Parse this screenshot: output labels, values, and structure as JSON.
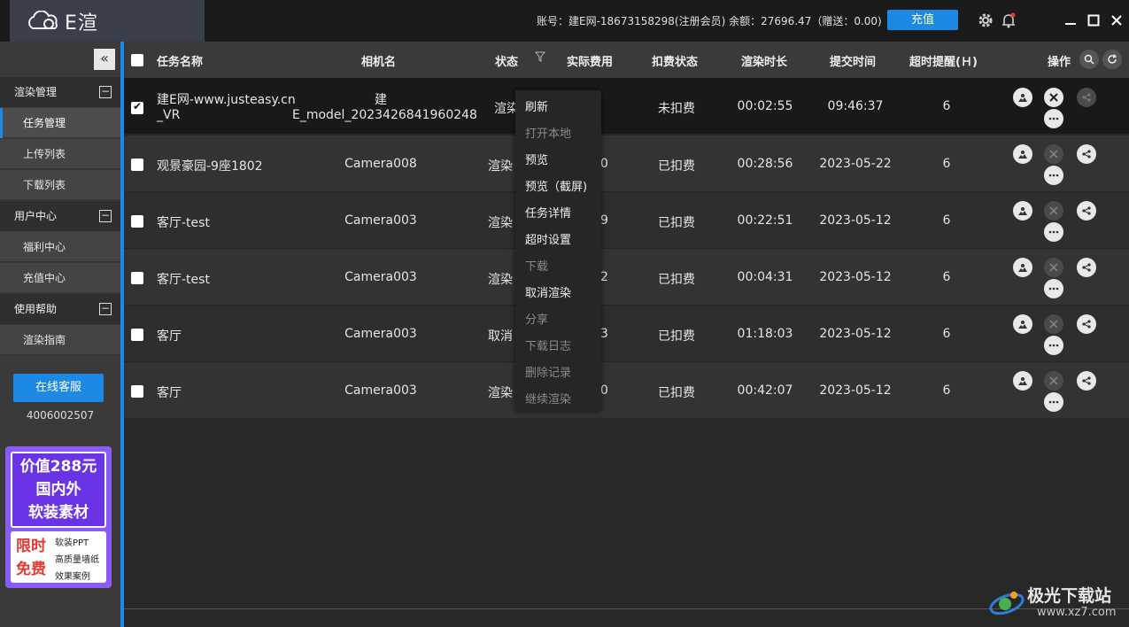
{
  "app": {
    "logo_text": "E渲",
    "account_info": "账号：建E网-18673158298(注册会员) 余额：27696.47（赠送：0.00)",
    "recharge_label": "充值"
  },
  "sidebar": {
    "collapse_glyph": "«",
    "groups": [
      {
        "label": "渲染管理",
        "toggle": "−"
      },
      {
        "label": "用户中心",
        "toggle": "−"
      },
      {
        "label": "使用帮助",
        "toggle": "−"
      }
    ],
    "items": [
      {
        "label": "任务管理"
      },
      {
        "label": "上传列表"
      },
      {
        "label": "下载列表"
      },
      {
        "label": "福利中心"
      },
      {
        "label": "充值中心"
      },
      {
        "label": "渲染指南"
      }
    ],
    "service_button": "在线客服",
    "phone": "4006002507",
    "promo": {
      "line1": "价值288元",
      "line2": "国内外",
      "line3": "软装素材",
      "badge1": "限时",
      "badge2": "免费",
      "list": [
        "软装PPT",
        "高质量墙纸",
        "效果案例"
      ]
    }
  },
  "table": {
    "headers": {
      "name": "任务名称",
      "camera": "相机名",
      "status": "状态",
      "cost": "实际费用",
      "charge_status": "扣费状态",
      "duration": "渲染时长",
      "submit_time": "提交时间",
      "timeout": "超时提醒(Ｈ)",
      "ops": "操作"
    },
    "rows": [
      {
        "name1": "建E网-www.justeasy.cn",
        "name2": "_VR",
        "camera1": "建",
        "camera2": "E_model_2023426841960248",
        "status": "渲染",
        "cost": "",
        "charge": "未扣费",
        "duration": "00:02:55",
        "time": "09:46:37",
        "timeout": "6"
      },
      {
        "name1": "观景豪园-9座1802",
        "name2": "",
        "camera1": "Camera008",
        "camera2": "",
        "status": "渲染",
        "cost": "0",
        "charge": "已扣费",
        "duration": "00:28:56",
        "time": "2023-05-22",
        "timeout": "6"
      },
      {
        "name1": "客厅-test",
        "name2": "",
        "camera1": "Camera003",
        "camera2": "",
        "status": "渲染",
        "cost": "9",
        "charge": "已扣费",
        "duration": "00:22:51",
        "time": "2023-05-12",
        "timeout": "6"
      },
      {
        "name1": "客厅-test",
        "name2": "",
        "camera1": "Camera003",
        "camera2": "",
        "status": "渲染",
        "cost": "2",
        "charge": "已扣费",
        "duration": "00:04:31",
        "time": "2023-05-12",
        "timeout": "6"
      },
      {
        "name1": "客厅",
        "name2": "",
        "camera1": "Camera003",
        "camera2": "",
        "status": "取消",
        "cost": "3",
        "charge": "已扣费",
        "duration": "01:18:03",
        "time": "2023-05-12",
        "timeout": "6"
      },
      {
        "name1": "客厅",
        "name2": "",
        "camera1": "Camera003",
        "camera2": "",
        "status": "渲染",
        "cost": "0",
        "charge": "已扣费",
        "duration": "00:42:07",
        "time": "2023-05-12",
        "timeout": "6"
      }
    ]
  },
  "context_menu": {
    "items": [
      {
        "label": "刷新",
        "enabled": true
      },
      {
        "label": "打开本地",
        "enabled": false
      },
      {
        "label": "预览",
        "enabled": true
      },
      {
        "label": "预览（截屏)",
        "enabled": true
      },
      {
        "label": "任务详情",
        "enabled": true
      },
      {
        "label": "超时设置",
        "enabled": true
      },
      {
        "label": "下载",
        "enabled": false
      },
      {
        "label": "取消渲染",
        "enabled": true
      },
      {
        "label": "分享",
        "enabled": false
      },
      {
        "label": "下载日志",
        "enabled": false
      },
      {
        "label": "删除记录",
        "enabled": false
      },
      {
        "label": "继续渲染",
        "enabled": false
      }
    ]
  },
  "watermark": {
    "title": "极光下载站",
    "url": "www.xz7.com"
  },
  "colors": {
    "accent": "#1e88e5",
    "background": "#282828",
    "sidebar": "#3a3a3a"
  }
}
